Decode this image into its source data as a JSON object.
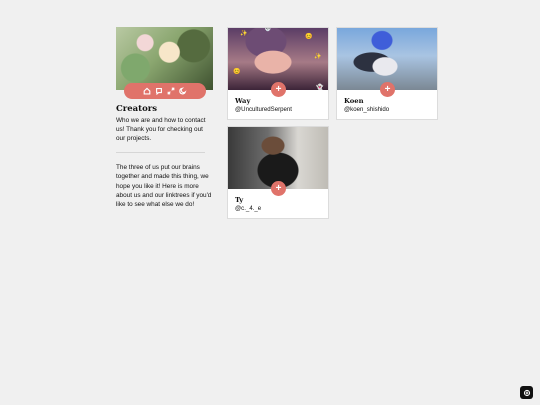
{
  "sidebar": {
    "title": "Creators",
    "description": "Who we are and how to contact us! Thank you for checking out our projects.",
    "body": "The three of us put our brains together and made this thing, we hope you like it! Here is more about us and our linktrees if you'd like to see what else we do!",
    "icons": [
      "home-icon",
      "chat-icon",
      "expand-icon",
      "moon-icon"
    ]
  },
  "cards": [
    {
      "name": "Way",
      "handle": "@UnculturedSerpent",
      "plus": "+"
    },
    {
      "name": "Koen",
      "handle": "@koen_shishido",
      "plus": "+"
    },
    {
      "name": "Ty",
      "handle": "@c._4._e",
      "plus": "+"
    }
  ],
  "colors": {
    "accent": "#e0736a",
    "background": "#f0f0f0"
  },
  "corner_button_icon": "sparkle-icon"
}
